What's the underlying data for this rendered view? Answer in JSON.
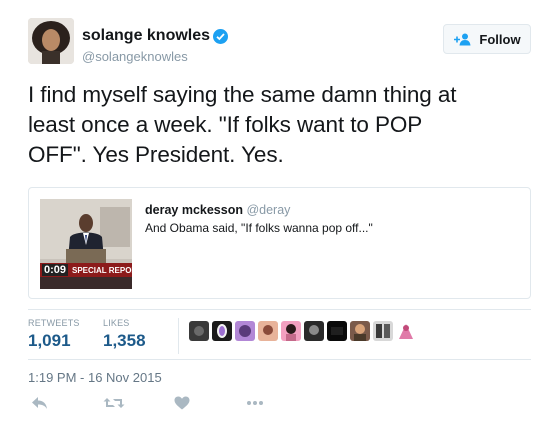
{
  "author": {
    "display_name": "solange knowles",
    "handle": "@solangeknowles",
    "verified": true
  },
  "follow_button": {
    "label": "Follow",
    "icon": "add-user-icon"
  },
  "tweet": {
    "lines": [
      "I find myself saying the same damn thing at",
      "least once a week. \"If folks want to POP",
      "OFF\". Yes President. Yes."
    ]
  },
  "quoted_tweet": {
    "display_name": "deray mckesson",
    "handle": "@deray",
    "text": "And Obama said, \"If folks wanna pop off...\"",
    "thumbnail": {
      "time_label": "0:09",
      "banner_text": "SPECIAL REPOR"
    }
  },
  "stats": {
    "retweets_label": "RETWEETS",
    "retweets_value": "1,091",
    "likes_label": "LIKES",
    "likes_value": "1,358"
  },
  "timestamp": "1:19 PM - 16 Nov 2015",
  "actions": [
    "reply-icon",
    "retweet-icon",
    "like-icon",
    "more-icon"
  ],
  "colors": {
    "verified_blue": "#1da1f2",
    "stat_blue": "#1d5a8a",
    "muted_text": "#8899a6",
    "border": "#e1e8ed"
  }
}
